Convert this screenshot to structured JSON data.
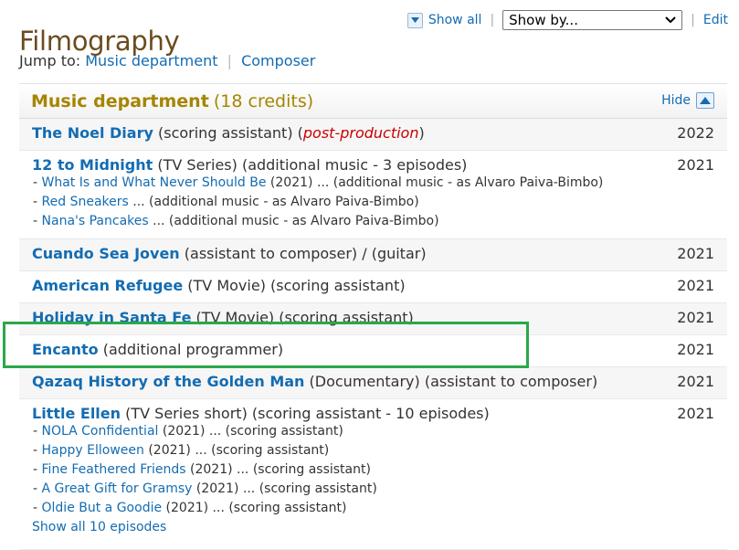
{
  "page": {
    "title": "Filmography"
  },
  "top_controls": {
    "show_all": "Show all",
    "separator": "|",
    "select_value": "Show by...",
    "edit": "Edit"
  },
  "jump": {
    "label": "Jump to:",
    "links": [
      "Music department",
      "Composer"
    ],
    "separator": "|"
  },
  "section": {
    "title": "Music department",
    "count": "(18 credits)",
    "hide": "Hide"
  },
  "credits": [
    {
      "title": "The Noel Diary",
      "desc": " (scoring assistant) (",
      "status": "post-production",
      "desc_end": ")",
      "year": "2022"
    },
    {
      "title": "12 to Midnight",
      "desc": " (TV Series) (additional music - 3 episodes)",
      "year": "2021",
      "episodes": [
        {
          "dash": "- ",
          "title": "What Is and What Never Should Be",
          "rest": " (2021) ... (additional music - as Alvaro Paiva-Bimbo)"
        },
        {
          "dash": "- ",
          "title": "Red Sneakers",
          "rest": " ... (additional music - as Alvaro Paiva-Bimbo)"
        },
        {
          "dash": "- ",
          "title": "Nana's Pancakes",
          "rest": " ... (additional music - as Alvaro Paiva-Bimbo)"
        }
      ]
    },
    {
      "title": "Cuando Sea Joven",
      "desc": " (assistant to composer) / (guitar)",
      "year": "2021"
    },
    {
      "title": "American Refugee",
      "desc": " (TV Movie) (scoring assistant)",
      "year": "2021"
    },
    {
      "title": "Holiday in Santa Fe",
      "desc": " (TV Movie) (scoring assistant)",
      "year": "2021"
    },
    {
      "title": "Encanto",
      "desc": " (additional programmer)",
      "year": "2021"
    },
    {
      "title": "Qazaq History of the Golden Man",
      "desc": " (Documentary) (assistant to composer)",
      "year": "2021"
    },
    {
      "title": "Little Ellen",
      "desc": " (TV Series short) (scoring assistant - 10 episodes)",
      "year": "2021",
      "episodes": [
        {
          "dash": "- ",
          "title": "NOLA Confidential",
          "rest": " (2021) ... (scoring assistant)"
        },
        {
          "dash": "- ",
          "title": "Happy Elloween",
          "rest": " (2021) ... (scoring assistant)"
        },
        {
          "dash": "- ",
          "title": "Fine Feathered Friends",
          "rest": " (2021) ... (scoring assistant)"
        },
        {
          "dash": "- ",
          "title": "A Great Gift for Gramsy",
          "rest": " (2021) ... (scoring assistant)"
        },
        {
          "dash": "- ",
          "title": "Oldie But a Goodie",
          "rest": " (2021) ... (scoring assistant)"
        }
      ],
      "show_all": "Show all 10 episodes"
    }
  ],
  "colors": {
    "title": "#6a4c1f",
    "section": "#a58500",
    "link": "#136cb2",
    "status": "#cc0000",
    "highlight": "#2ba84a"
  },
  "icons": {
    "show_all": "down-triangle-icon",
    "hide": "up-triangle-icon",
    "select": "chevron-down-icon"
  }
}
